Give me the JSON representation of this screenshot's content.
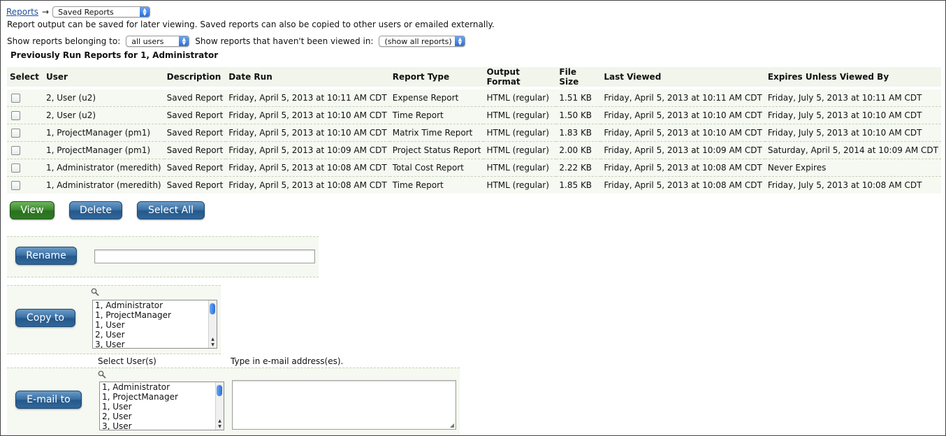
{
  "breadcrumb": {
    "link": "Reports",
    "arrow": "→",
    "selected": "Saved Reports"
  },
  "intro": "Report output can be saved for later viewing. Saved reports can also be copied to other users or emailed externally.",
  "filters": {
    "belonging_label": "Show reports belonging to:",
    "belonging_value": "all users",
    "viewed_label": "Show reports that haven't been viewed in:",
    "viewed_value": "(show all reports)"
  },
  "caption": "Previously Run Reports for 1, Administrator",
  "table": {
    "headers": [
      "Select",
      "User",
      "Description",
      "Date Run",
      "Report Type",
      "Output Format",
      "File Size",
      "Last Viewed",
      "Expires Unless Viewed By"
    ],
    "rows": [
      [
        "2, User (u2)",
        "Saved Report",
        "Friday, April 5, 2013 at 10:11 AM CDT",
        "Expense Report",
        "HTML (regular)",
        "1.51 KB",
        "Friday, April 5, 2013 at 10:11 AM CDT",
        "Friday, July 5, 2013 at 10:11 AM CDT"
      ],
      [
        "2, User (u2)",
        "Saved Report",
        "Friday, April 5, 2013 at 10:10 AM CDT",
        "Time Report",
        "HTML (regular)",
        "1.50 KB",
        "Friday, April 5, 2013 at 10:10 AM CDT",
        "Friday, July 5, 2013 at 10:10 AM CDT"
      ],
      [
        "1, ProjectManager (pm1)",
        "Saved Report",
        "Friday, April 5, 2013 at 10:10 AM CDT",
        "Matrix Time Report",
        "HTML (regular)",
        "1.83 KB",
        "Friday, April 5, 2013 at 10:10 AM CDT",
        "Friday, July 5, 2013 at 10:10 AM CDT"
      ],
      [
        "1, ProjectManager (pm1)",
        "Saved Report",
        "Friday, April 5, 2013 at 10:09 AM CDT",
        "Project Status Report",
        "HTML (regular)",
        "2.00 KB",
        "Friday, April 5, 2013 at 10:09 AM CDT",
        "Saturday, April 5, 2014 at 10:09 AM CDT"
      ],
      [
        "1, Administrator (meredith)",
        "Saved Report",
        "Friday, April 5, 2013 at 10:08 AM CDT",
        "Total Cost Report",
        "HTML (regular)",
        "2.22 KB",
        "Friday, April 5, 2013 at 10:08 AM CDT",
        "Never Expires"
      ],
      [
        "1, Administrator (meredith)",
        "Saved Report",
        "Friday, April 5, 2013 at 10:08 AM CDT",
        "Time Report",
        "HTML (regular)",
        "1.85 KB",
        "Friday, April 5, 2013 at 10:08 AM CDT",
        "Friday, July 5, 2013 at 10:08 AM CDT"
      ]
    ]
  },
  "actions": {
    "view": "View",
    "delete": "Delete",
    "select_all": "Select All"
  },
  "rename": {
    "button": "Rename",
    "value": ""
  },
  "copy": {
    "button": "Copy to",
    "options": [
      "1, Administrator",
      "1, ProjectManager",
      "1, User",
      "2, User",
      "3, User"
    ]
  },
  "email": {
    "button": "E-mail to",
    "users_label": "Select User(s)",
    "address_label": "Type in e-mail address(es).",
    "options": [
      "1, Administrator",
      "1, ProjectManager",
      "1, User",
      "2, User",
      "3, User"
    ],
    "addresses": ""
  },
  "icons": {
    "magnifier": "magnifier-icon",
    "cursor": "mouse-pointer-icon"
  },
  "colors": {
    "accent": "#2f679c",
    "view_button": "#3e8c2f",
    "row_bg": "#f5f9f1"
  }
}
